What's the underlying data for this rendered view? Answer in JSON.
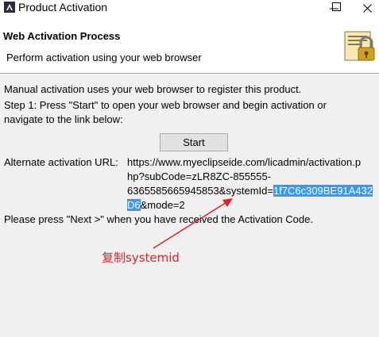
{
  "window": {
    "title": "Product Activation"
  },
  "header": {
    "title": "Web Activation Process",
    "description": "Perform activation using your web browser"
  },
  "body": {
    "intro": "Manual activation uses your web browser to register this product.",
    "step1_line1": "Step 1: Press \"Start\" to open your web browser and begin activation or",
    "step1_line2": "navigate to the link below:",
    "start_label": "Start",
    "alt_url_label": "Alternate activation URL:",
    "url_line1": "https://www.myeclipseide.com/licadmin/activation.p",
    "url_line2": "hp?subCode=zLR8ZC-855555-",
    "url_line3_plain": "6365585665945853&systemId=",
    "url_line3_selected": "1f7C6c309BE91A432",
    "url_line4_selected": "D6",
    "url_line4_plain": "&mode=2",
    "next_hint": "Please press \"Next >\" when you have received the Activation Code."
  },
  "annotation": {
    "text": "复制systemid",
    "color": "#e81e25"
  },
  "colors": {
    "selection": "#3399ff",
    "content_bg": "#f0f0f0"
  }
}
